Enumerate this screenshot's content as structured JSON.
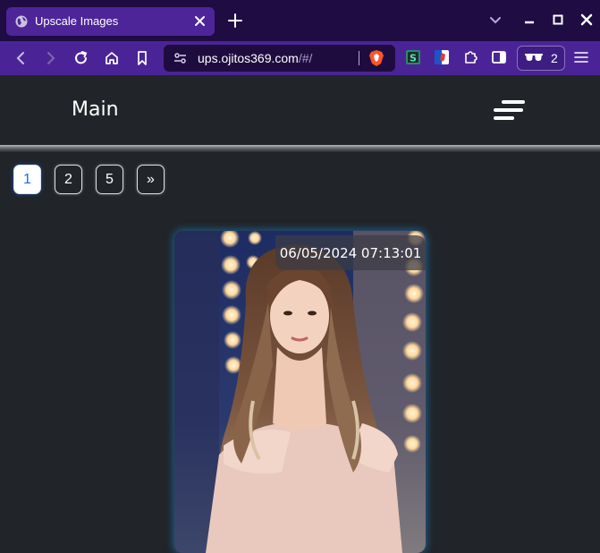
{
  "browser": {
    "tab_title": "Upscale Images",
    "url_host": "ups.ojitos369.com",
    "url_path": "/#/",
    "profile_count": "2",
    "colors": {
      "tabbar": "#1e0c42",
      "tab_active": "#4d2599",
      "toolbar": "#4a2496"
    }
  },
  "page": {
    "brand": "Main",
    "pagination": [
      {
        "label": "1",
        "active": true
      },
      {
        "label": "2",
        "active": false
      },
      {
        "label": "5",
        "active": false
      },
      {
        "label": "»",
        "active": false
      }
    ],
    "cards": [
      {
        "timestamp": "06/05/2024 07:13:01"
      }
    ]
  },
  "colors": {
    "page_bg": "#212529",
    "active_page": "#0d6efd",
    "card_glow": "#1e82c8"
  }
}
